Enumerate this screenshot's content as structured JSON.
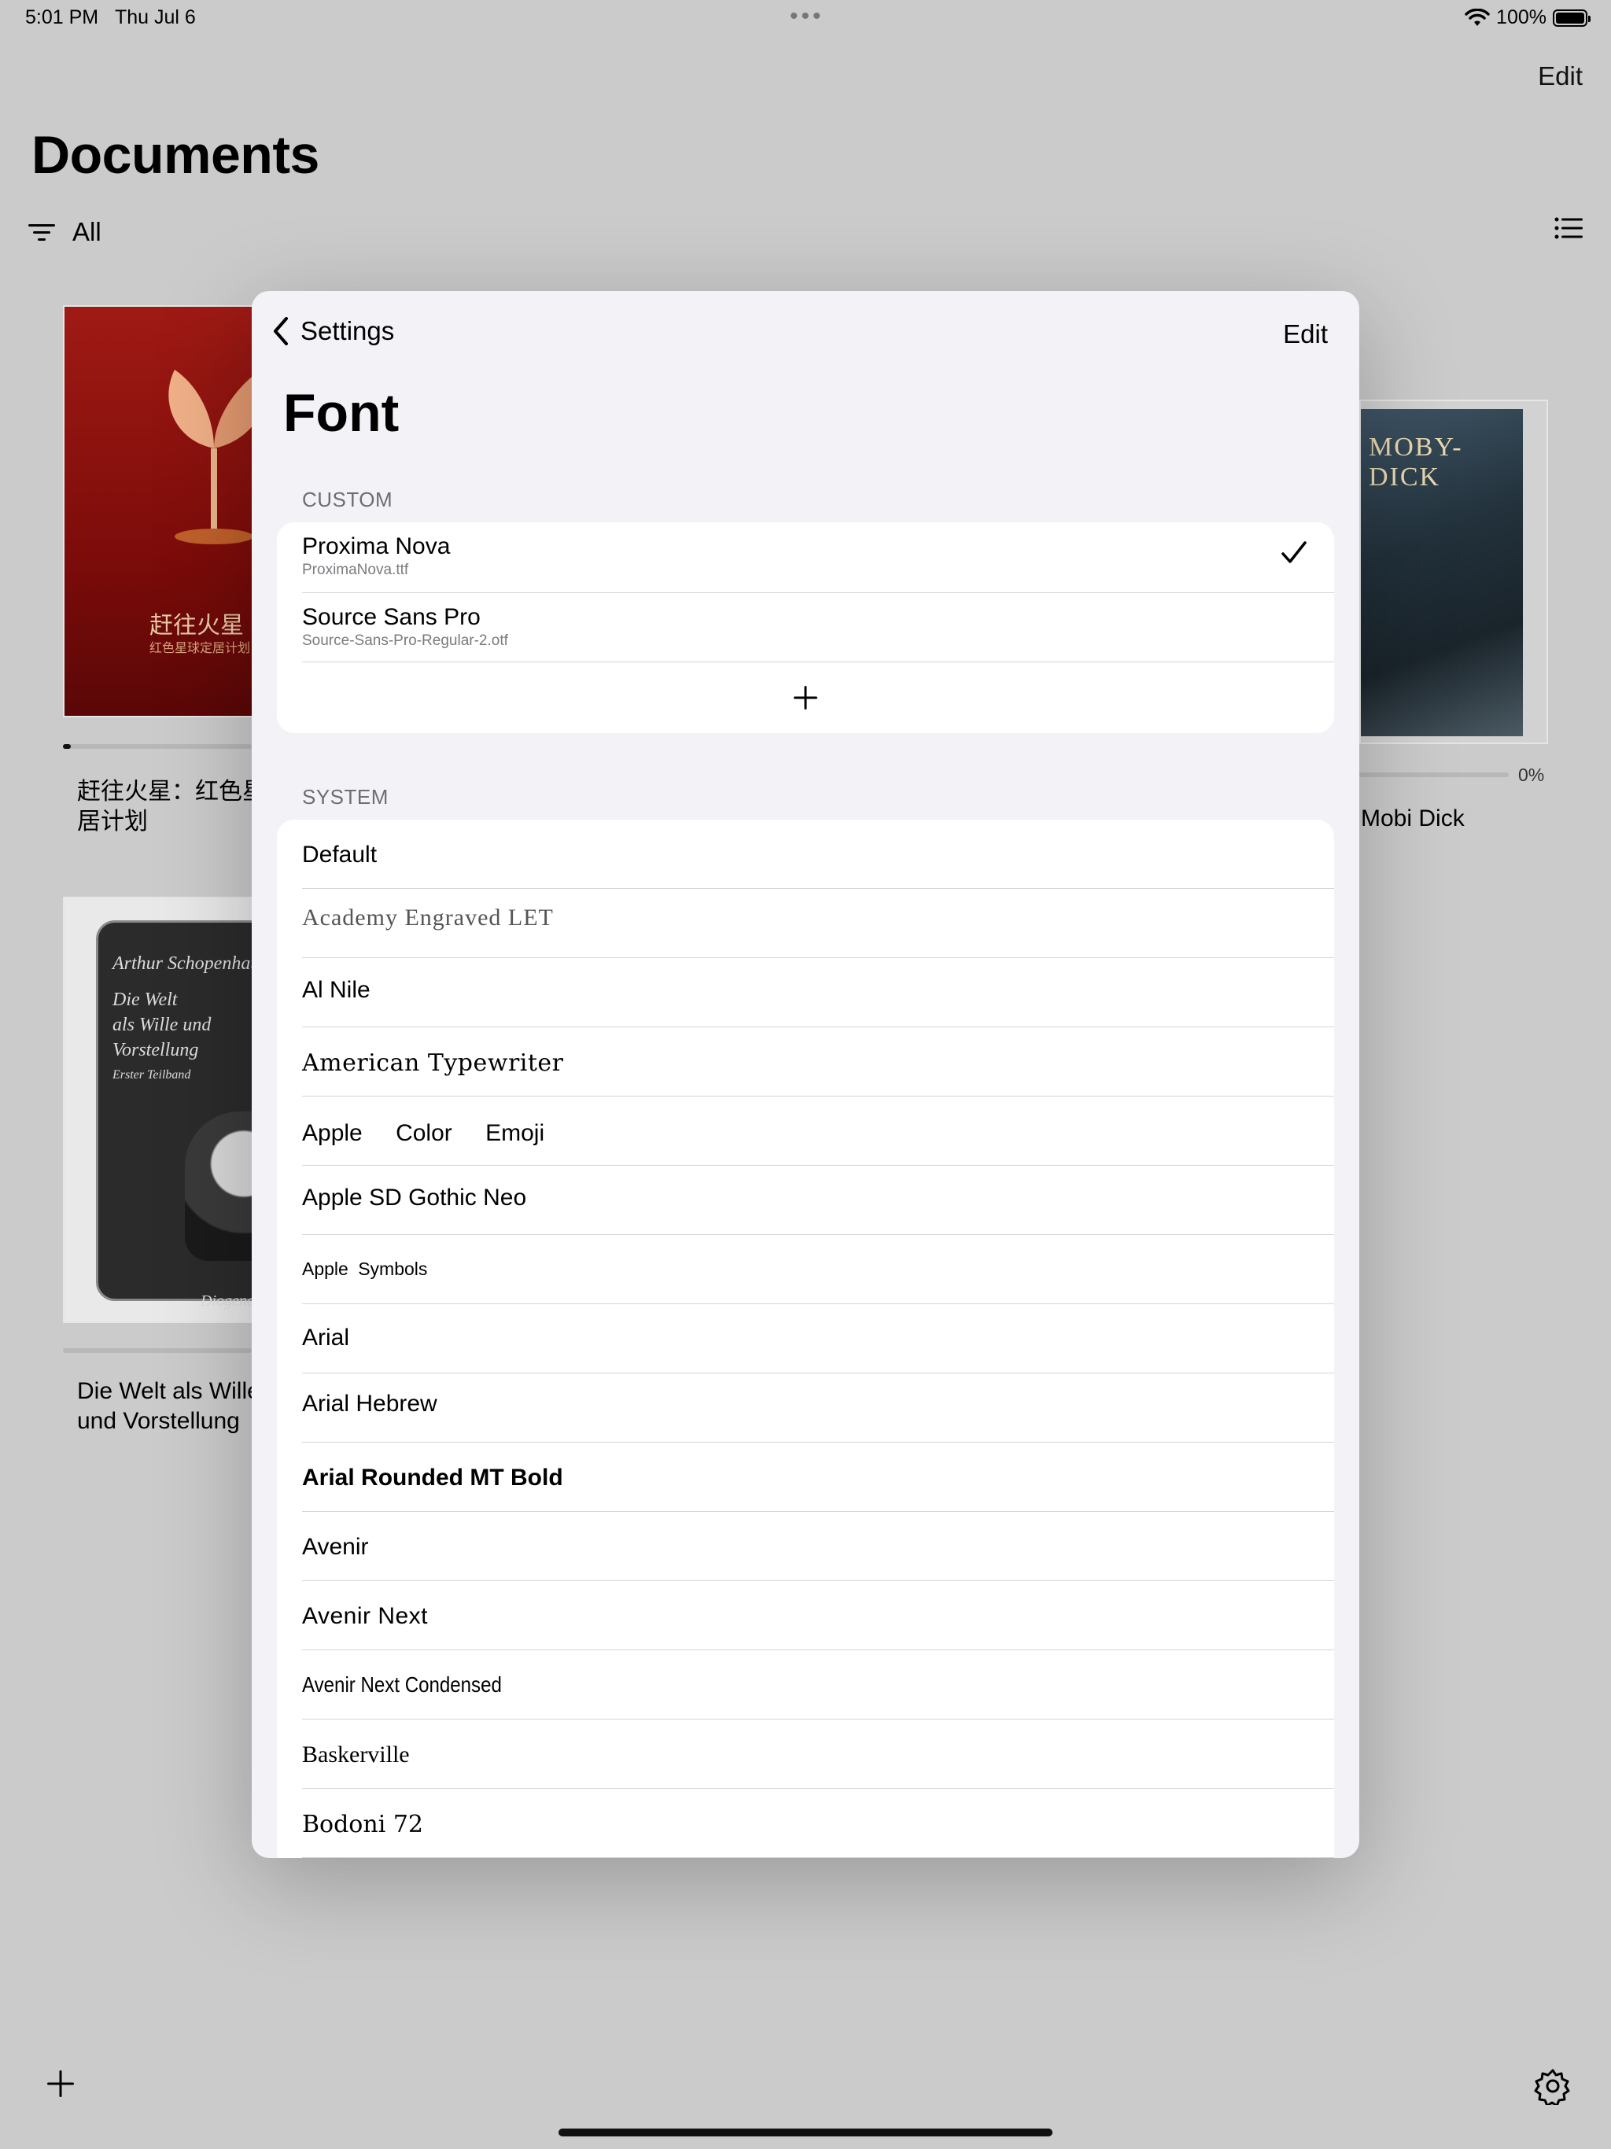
{
  "status_bar": {
    "time": "5:01 PM",
    "date": "Thu Jul 6",
    "battery_text": "100%"
  },
  "library": {
    "edit_label": "Edit",
    "title": "Documents",
    "filter_label": "All",
    "books": [
      {
        "cover_title": "赶往火星",
        "cover_subtitle": "红色星球定居计划",
        "title": "赶往火星：红色星居计划",
        "progress": 0.04
      },
      {
        "cover_title": "MOBY-DICK",
        "title": "Mobi Dick",
        "progress_text": "0%",
        "progress": 0
      },
      {
        "cover_author": "Arthur Schopenhauer",
        "cover_title_line1": "Die Welt",
        "cover_title_line2": "als Wille und",
        "cover_title_line3": "Vorstellung",
        "cover_sub": "Erster Teilband",
        "cover_publisher": "Diogenes",
        "title": "Die Welt als Wille und Vorstellung",
        "progress": 0
      }
    ]
  },
  "modal": {
    "back_label": "Settings",
    "edit_label": "Edit",
    "title": "Font",
    "custom_header": "CUSTOM",
    "custom_fonts": [
      {
        "name": "Proxima Nova",
        "file": "ProximaNova.ttf",
        "selected": true
      },
      {
        "name": "Source Sans Pro",
        "file": "Source-Sans-Pro-Regular-2.otf",
        "selected": false
      }
    ],
    "system_header": "SYSTEM",
    "system_fonts": [
      "Default",
      "Academy Engraved LET",
      "Al Nile",
      "American Typewriter",
      "Apple Color Emoji",
      "Apple SD Gothic Neo",
      "Apple Symbols",
      "Arial",
      "Arial Hebrew",
      "Arial Rounded MT Bold",
      "Avenir",
      "Avenir Next",
      "Avenir Next Condensed",
      "Baskerville",
      "Bodoni 72"
    ]
  }
}
